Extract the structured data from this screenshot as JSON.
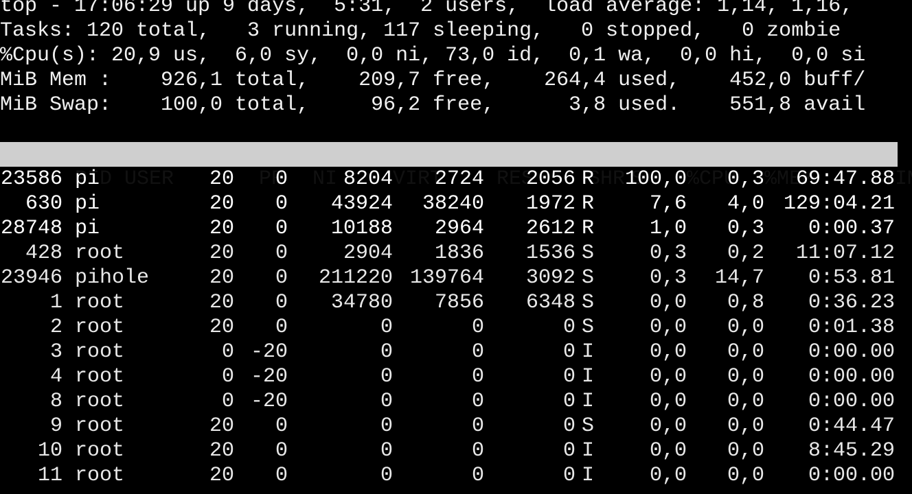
{
  "summary": {
    "line1": "top - 17:06:29 up 9 days,  5:31,  2 users,  load average: 1,14, 1,16,",
    "line2": "Tasks: 120 total,   3 running, 117 sleeping,   0 stopped,   0 zombie",
    "line3": "%Cpu(s): 20,9 us,  6,0 sy,  0,0 ni, 73,0 id,  0,1 wa,  0,0 hi,  0,0 si",
    "line4": "MiB Mem :    926,1 total,    209,7 free,    264,4 used,    452,0 buff/",
    "line5": "MiB Swap:    100,0 total,     96,2 free,      3,8 used.    551,8 avail"
  },
  "columns": {
    "pid": "PID",
    "user": "USER",
    "pr": "PR",
    "ni": "NI",
    "virt": "VIRT",
    "res": "RES",
    "shr": "SHR",
    "s": "S",
    "cpu": "%CPU",
    "mem": "%MEM",
    "time": "TIME+"
  },
  "processes": [
    {
      "pid": "23586",
      "user": "pi",
      "pr": "20",
      "ni": "0",
      "virt": "8204",
      "res": "2724",
      "shr": "2056",
      "s": "R",
      "cpu": "100,0",
      "mem": "0,3",
      "time": "69:47.88"
    },
    {
      "pid": "630",
      "user": "pi",
      "pr": "20",
      "ni": "0",
      "virt": "43924",
      "res": "38240",
      "shr": "1972",
      "s": "R",
      "cpu": "7,6",
      "mem": "4,0",
      "time": "129:04.21"
    },
    {
      "pid": "28748",
      "user": "pi",
      "pr": "20",
      "ni": "0",
      "virt": "10188",
      "res": "2964",
      "shr": "2612",
      "s": "R",
      "cpu": "1,0",
      "mem": "0,3",
      "time": "0:00.37"
    },
    {
      "pid": "428",
      "user": "root",
      "pr": "20",
      "ni": "0",
      "virt": "2904",
      "res": "1836",
      "shr": "1536",
      "s": "S",
      "cpu": "0,3",
      "mem": "0,2",
      "time": "11:07.12"
    },
    {
      "pid": "23946",
      "user": "pihole",
      "pr": "20",
      "ni": "0",
      "virt": "211220",
      "res": "139764",
      "shr": "3092",
      "s": "S",
      "cpu": "0,3",
      "mem": "14,7",
      "time": "0:53.81"
    },
    {
      "pid": "1",
      "user": "root",
      "pr": "20",
      "ni": "0",
      "virt": "34780",
      "res": "7856",
      "shr": "6348",
      "s": "S",
      "cpu": "0,0",
      "mem": "0,8",
      "time": "0:36.23"
    },
    {
      "pid": "2",
      "user": "root",
      "pr": "20",
      "ni": "0",
      "virt": "0",
      "res": "0",
      "shr": "0",
      "s": "S",
      "cpu": "0,0",
      "mem": "0,0",
      "time": "0:01.38"
    },
    {
      "pid": "3",
      "user": "root",
      "pr": "0",
      "ni": "-20",
      "virt": "0",
      "res": "0",
      "shr": "0",
      "s": "I",
      "cpu": "0,0",
      "mem": "0,0",
      "time": "0:00.00"
    },
    {
      "pid": "4",
      "user": "root",
      "pr": "0",
      "ni": "-20",
      "virt": "0",
      "res": "0",
      "shr": "0",
      "s": "I",
      "cpu": "0,0",
      "mem": "0,0",
      "time": "0:00.00"
    },
    {
      "pid": "8",
      "user": "root",
      "pr": "0",
      "ni": "-20",
      "virt": "0",
      "res": "0",
      "shr": "0",
      "s": "I",
      "cpu": "0,0",
      "mem": "0,0",
      "time": "0:00.00"
    },
    {
      "pid": "9",
      "user": "root",
      "pr": "20",
      "ni": "0",
      "virt": "0",
      "res": "0",
      "shr": "0",
      "s": "S",
      "cpu": "0,0",
      "mem": "0,0",
      "time": "0:44.47"
    },
    {
      "pid": "10",
      "user": "root",
      "pr": "20",
      "ni": "0",
      "virt": "0",
      "res": "0",
      "shr": "0",
      "s": "I",
      "cpu": "0,0",
      "mem": "0,0",
      "time": "8:45.29"
    },
    {
      "pid": "11",
      "user": "root",
      "pr": "20",
      "ni": "0",
      "virt": "0",
      "res": "0",
      "shr": "0",
      "s": "I",
      "cpu": "0,0",
      "mem": "0,0",
      "time": "0:00.00"
    }
  ]
}
